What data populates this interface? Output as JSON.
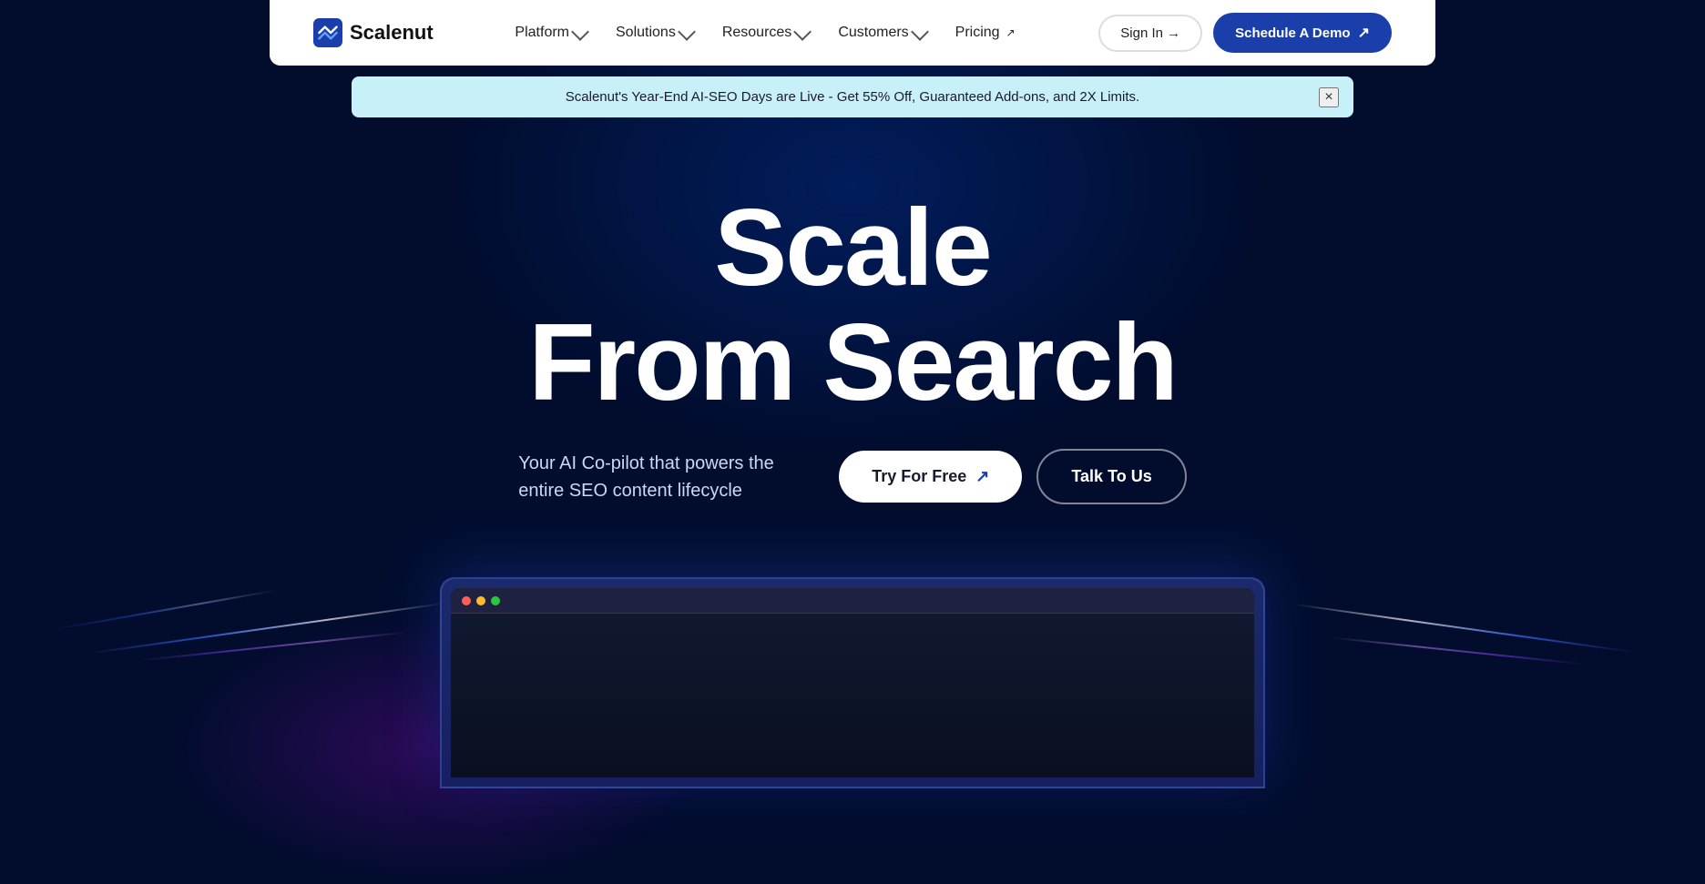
{
  "brand": {
    "name": "Scalenut",
    "logo_text": "scalenut"
  },
  "nav": {
    "links": [
      {
        "label": "Platform",
        "has_dropdown": true
      },
      {
        "label": "Solutions",
        "has_dropdown": true
      },
      {
        "label": "Resources",
        "has_dropdown": true
      },
      {
        "label": "Customers",
        "has_dropdown": true
      },
      {
        "label": "Pricing",
        "has_external": true
      }
    ],
    "signin_label": "Sign In →",
    "demo_label": "Schedule A Demo",
    "demo_arrow": "↗"
  },
  "banner": {
    "text": "Scalenut's Year-End AI-SEO Days are Live - Get 55% Off, Guaranteed Add-ons, and 2X Limits.",
    "close_label": "×"
  },
  "hero": {
    "title_line1": "Scale",
    "title_line2": "From Search",
    "description": "Your AI Co-pilot that powers the entire SEO content lifecycle",
    "try_label": "Try For Free",
    "talk_label": "Talk To Us"
  },
  "colors": {
    "bg_dark": "#020d2e",
    "nav_bg": "#ffffff",
    "banner_bg": "#c8f0f8",
    "btn_primary": "#1a3faa",
    "text_light": "#ffffff",
    "text_muted": "#c8d8f8"
  }
}
